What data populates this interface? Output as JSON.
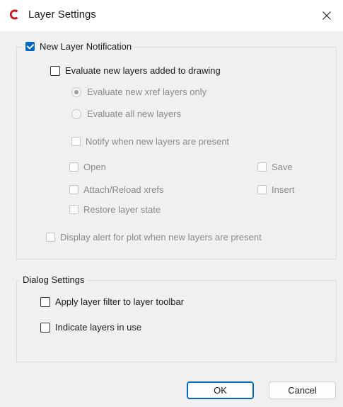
{
  "window": {
    "title": "Layer Settings",
    "icon": "autocad-c-logo-icon",
    "close_icon": "close-icon",
    "accent_color": "#0067c0",
    "logo_color": "#c7161d"
  },
  "new_layer_notification": {
    "label": "New Layer Notification",
    "checked": true,
    "evaluate_new_layers": {
      "label": "Evaluate new layers added to drawing",
      "checked": false
    },
    "radio_xref_only": {
      "label": "Evaluate new xref layers only",
      "selected": true,
      "enabled": false
    },
    "radio_all_layers": {
      "label": "Evaluate all new layers",
      "selected": false,
      "enabled": false
    },
    "notify_present": {
      "label": "Notify when new layers are present",
      "checked": false,
      "enabled": false
    },
    "open": {
      "label": "Open",
      "checked": false,
      "enabled": false
    },
    "save": {
      "label": "Save",
      "checked": false,
      "enabled": false
    },
    "attach_reload": {
      "label": "Attach/Reload xrefs",
      "checked": false,
      "enabled": false
    },
    "insert": {
      "label": "Insert",
      "checked": false,
      "enabled": false
    },
    "restore_state": {
      "label": "Restore layer state",
      "checked": false,
      "enabled": false
    },
    "display_alert_plot": {
      "label": "Display alert for plot when new layers are present",
      "checked": false,
      "enabled": false
    }
  },
  "dialog_settings": {
    "title": "Dialog Settings",
    "apply_filter": {
      "label": "Apply layer filter to layer toolbar",
      "checked": false
    },
    "indicate_in_use": {
      "label": "Indicate layers in use",
      "checked": false
    }
  },
  "buttons": {
    "ok": "OK",
    "cancel": "Cancel"
  }
}
